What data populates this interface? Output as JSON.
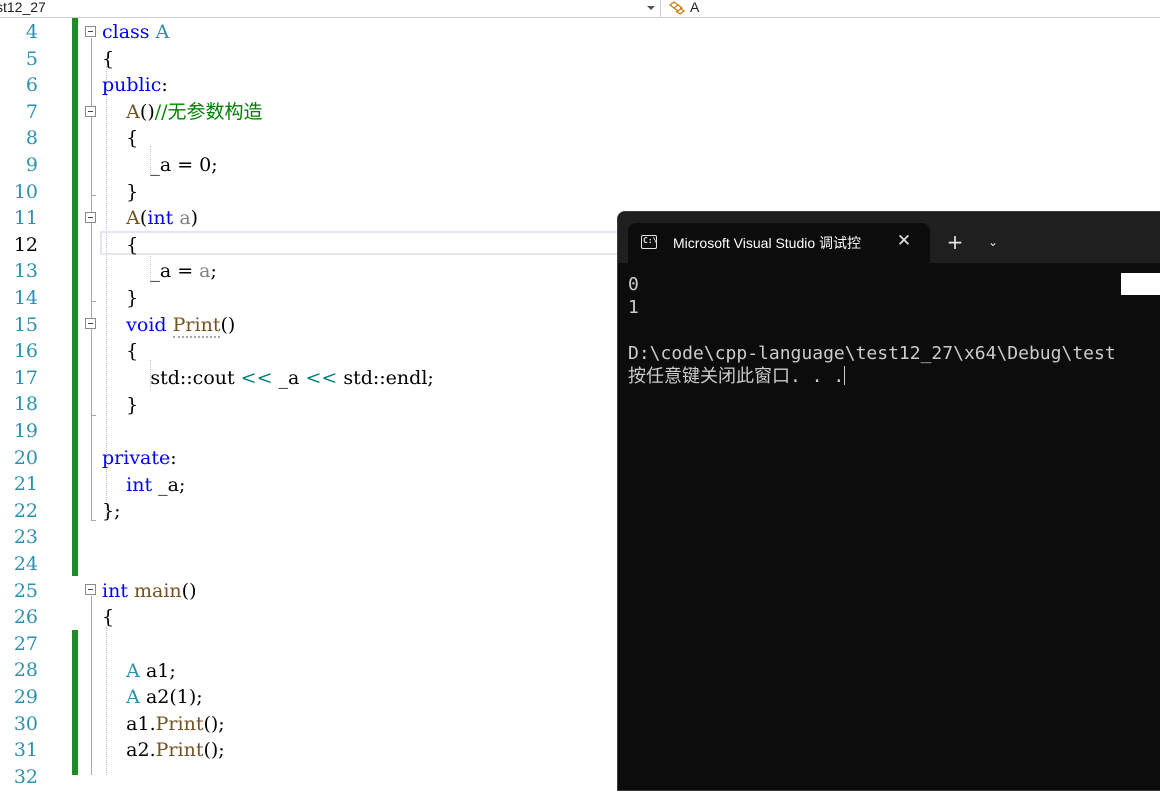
{
  "navbar": {
    "project": "st12_27",
    "class_scope": "A",
    "class_icon": "class-scope-icon"
  },
  "editor": {
    "current_line": 12,
    "line_numbers": [
      "4",
      "5",
      "6",
      "7",
      "8",
      "9",
      "10",
      "11",
      "12",
      "13",
      "14",
      "15",
      "16",
      "17",
      "18",
      "19",
      "20",
      "21",
      "22",
      "23",
      "24",
      "25",
      "26",
      "27",
      "28",
      "29",
      "30",
      "31",
      "32"
    ],
    "code": {
      "l4_kw": "class",
      "l4_name": "A",
      "l5": "{",
      "l6_kw": "public",
      "l6_colon": ":",
      "l7_ctor": "A",
      "l7_parens": "()",
      "l7_comment": "//无参数构造",
      "l8": "{",
      "l9": "_a = 0;",
      "l10": "}",
      "l11_ctor": "A",
      "l11_open": "(",
      "l11_kw": "int",
      "l11_param": "a",
      "l11_close": ")",
      "l12": "{",
      "l13_a": "_a = ",
      "l13_param": "a",
      "l13_semi": ";",
      "l14": "}",
      "l15_kw": "void",
      "l15_fn": "Print",
      "l15_parens": "()",
      "l16": "{",
      "l17_std1": "std::cout ",
      "l17_op1": "<<",
      "l17_mid": " _a ",
      "l17_op2": "<<",
      "l17_std2": " std::endl;",
      "l18": "}",
      "l20_kw": "private",
      "l20_colon": ":",
      "l21_kw": "int",
      "l21_rest": " _a;",
      "l22": "};",
      "l25_kw": "int",
      "l25_fn": "main",
      "l25_parens": "()",
      "l26": "{",
      "l28_type": "A",
      "l28_rest": " a1;",
      "l29_type": "A",
      "l29_rest": " a2(1);",
      "l30_obj": "a1.",
      "l30_fn": "Print",
      "l30_rest": "();",
      "l31_obj": "a2.",
      "l31_fn": "Print",
      "l31_rest": "();"
    }
  },
  "console": {
    "tab_title": "Microsoft Visual Studio 调试控",
    "tab_icon": "terminal-icon",
    "tab_icon_text": "C:\\",
    "close_icon": "✕",
    "new_tab_icon": "+",
    "dropdown_icon": "⌄",
    "output": [
      "0",
      "1",
      "",
      "D:\\code\\cpp-language\\test12_27\\x64\\Debug\\test",
      "按任意键关闭此窗口. . ."
    ]
  },
  "colors": {
    "keyword": "#0000ff",
    "type": "#2b91af",
    "comment": "#008000",
    "function": "#74531f",
    "change_bar": "#1f8a27",
    "console_bg": "#0c0c0c"
  }
}
